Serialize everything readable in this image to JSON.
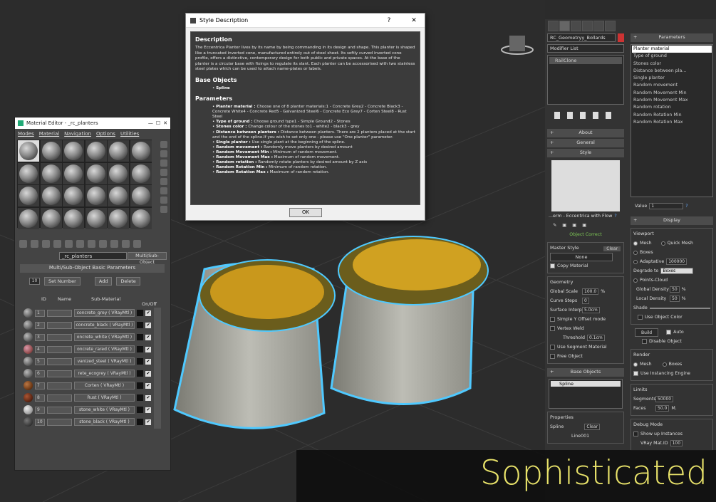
{
  "dialog": {
    "title": "Style Description",
    "help": "?",
    "close": "✕",
    "description_heading": "Description",
    "description": "The Eccentrica Planter lives by its name by being commanding in its design and shape. This planter is shaped like a truncated inverted cone, manufactured entirely out of steel sheet. Its softly curved inverted cone profile, offers a distinctive, contemporary design for both public and private spaces. At the base of the planter is a circular base with fixings to regulate its slant. Each planter can be accessorised with two stainless steel plates which can be used to attach name-plates or labels.",
    "base_heading": "Base Objects",
    "base_items": [
      "Spline"
    ],
    "params_heading": "Parameters",
    "params": [
      {
        "name": "Planter material :",
        "desc": "Choose one of 8 planter materials:1 - Concrete Grey2 - Concrete Black3 - Concrete White4 - Concrete Red5 - Galvanized Steel6 - Concrete Eco Grey7 - Corten Steel8 - Rust Steel"
      },
      {
        "name": "Type of ground :",
        "desc": "Choose ground type1 - Simple Ground2 - Stones"
      },
      {
        "name": "Stones color :",
        "desc": "Change colour of the stones to1 - white2 - black3 - grey"
      },
      {
        "name": "Distance between planters :",
        "desc": "Distance between planters. There are 2 planters placed at the start and the end of the spline.If you wish to set only one - please use \"One planter\" parameter."
      },
      {
        "name": "Single planter :",
        "desc": "Use single plant at the beginning of the spline."
      },
      {
        "name": "Random movement :",
        "desc": "Randomly move planters by desired amount"
      },
      {
        "name": "Random Movement Min :",
        "desc": "Minimum of random movement."
      },
      {
        "name": "Random Movement Max :",
        "desc": "Maximum of random movement."
      },
      {
        "name": "Random rotation :",
        "desc": "Randomly rotate planters by desired amount by Z axis"
      },
      {
        "name": "Random Rotation Min :",
        "desc": "Minimum of random rotation."
      },
      {
        "name": "Random Rotation Max :",
        "desc": "Maximum of random rotation."
      }
    ],
    "ok": "OK"
  },
  "material_editor": {
    "title": "Material Editor - _rc_planters",
    "menus": [
      "Modes",
      "Material",
      "Navigation",
      "Options",
      "Utilities"
    ],
    "material_name": "_rc_planters",
    "material_type": "Multi/Sub-Object",
    "rollout": "Multi/Sub-Object Basic Parameters",
    "count": "10",
    "set_number": "Set Number",
    "add": "Add",
    "delete": "Delete",
    "col_id": "ID",
    "col_name": "Name",
    "col_sub": "Sub-Material",
    "col_onoff": "On/Off",
    "rows": [
      {
        "id": "1",
        "sub": "concrete_grey  ( VRayMtl )"
      },
      {
        "id": "2",
        "sub": "concrete_black  ( VRayMtl )"
      },
      {
        "id": "3",
        "sub": "oncrete_white  ( VRayMtl )"
      },
      {
        "id": "4",
        "sub": "oncrete_rared  ( VRayMtl )"
      },
      {
        "id": "5",
        "sub": "vanized_steel  ( VRayMtl )"
      },
      {
        "id": "6",
        "sub": "rete_ecogrey  ( VRayMtl )"
      },
      {
        "id": "7",
        "sub": "Corten  ( VRayMtl )"
      },
      {
        "id": "8",
        "sub": "Rust  ( VRayMtl )"
      },
      {
        "id": "9",
        "sub": "stone_white  ( VRayMtl )"
      },
      {
        "id": "10",
        "sub": "stone_black  ( VRayMtl )"
      }
    ]
  },
  "command_panel": {
    "object_name": "RC_Geometryy_Bollards",
    "modifier_list": "Modifier List",
    "stack_item": "RailClone",
    "about": "About",
    "general": "General",
    "style": "Style",
    "style_name": "...erm - Eccentrica with Flow",
    "object_correct": "Object Correct",
    "master_style": "Master Style",
    "clear": "Clear",
    "none": "None",
    "copy_material": "Copy Material",
    "geometry": "Geometry",
    "global_scale_label": "Global Scale",
    "global_scale": "100.0",
    "curve_steps_label": "Curve Steps",
    "curve_steps": "0",
    "surface_interp_label": "Surface Interp.",
    "surface_interp": "5.0cm",
    "simple_y_offset": "Simple Y Offset mode",
    "vertex_weld": "Vertex Weld",
    "threshold_label": "Threshold",
    "threshold": "0.1cm",
    "use_segment_material": "Use Segment Material",
    "free_object": "Free Object",
    "base_objects": "Base Objects",
    "spline": "Spline",
    "properties": "Properties",
    "spline_label": "Spline",
    "line": "Line001",
    "parameters": "Parameters",
    "param_list": [
      "Planter material",
      "Type of ground",
      "Stones color",
      "Distance between pla...",
      "Single planter",
      "Random movement",
      "Random Movement Min",
      "Random Movement Max",
      "Random rotation",
      "Random Rotation Min",
      "Random Rotation Max"
    ],
    "value_label": "Value",
    "value": "1",
    "display": "Display",
    "viewport": "Viewport",
    "mesh": "Mesh",
    "quick_mesh": "Quick Mesh",
    "boxes": "Boxes",
    "adaptative": "Adaptative",
    "adaptative_val": "100000",
    "degrade_to": "Degrade to",
    "degrade_val": "Boxes",
    "points_cloud": "Points-Cloud",
    "global_density_label": "Global Density",
    "global_density": "50",
    "local_density_label": "Local Density",
    "local_density": "50",
    "shade": "Shade",
    "use_object_color": "Use Object Color",
    "build": "Build",
    "auto": "Auto",
    "disable_object": "Disable Object",
    "render": "Render",
    "render_mesh": "Mesh",
    "render_boxes": "Boxes",
    "use_instancing": "Use Instancing Engine",
    "limits": "Limits",
    "segments_label": "Segments",
    "segments": "50000",
    "faces_label": "Faces",
    "faces": "50.0",
    "faces_unit": "M.",
    "debug_mode": "Debug Mode",
    "show_up_instances": "Show up Instances",
    "vray_mat_id_label": "VRay Mat.ID",
    "vray_mat_id": "100"
  },
  "overlay_text": "Sophisticated",
  "colors": {
    "accent": "#e9e36a",
    "selection_outline": "#4fc9ff",
    "flower": "#d9a21c"
  }
}
